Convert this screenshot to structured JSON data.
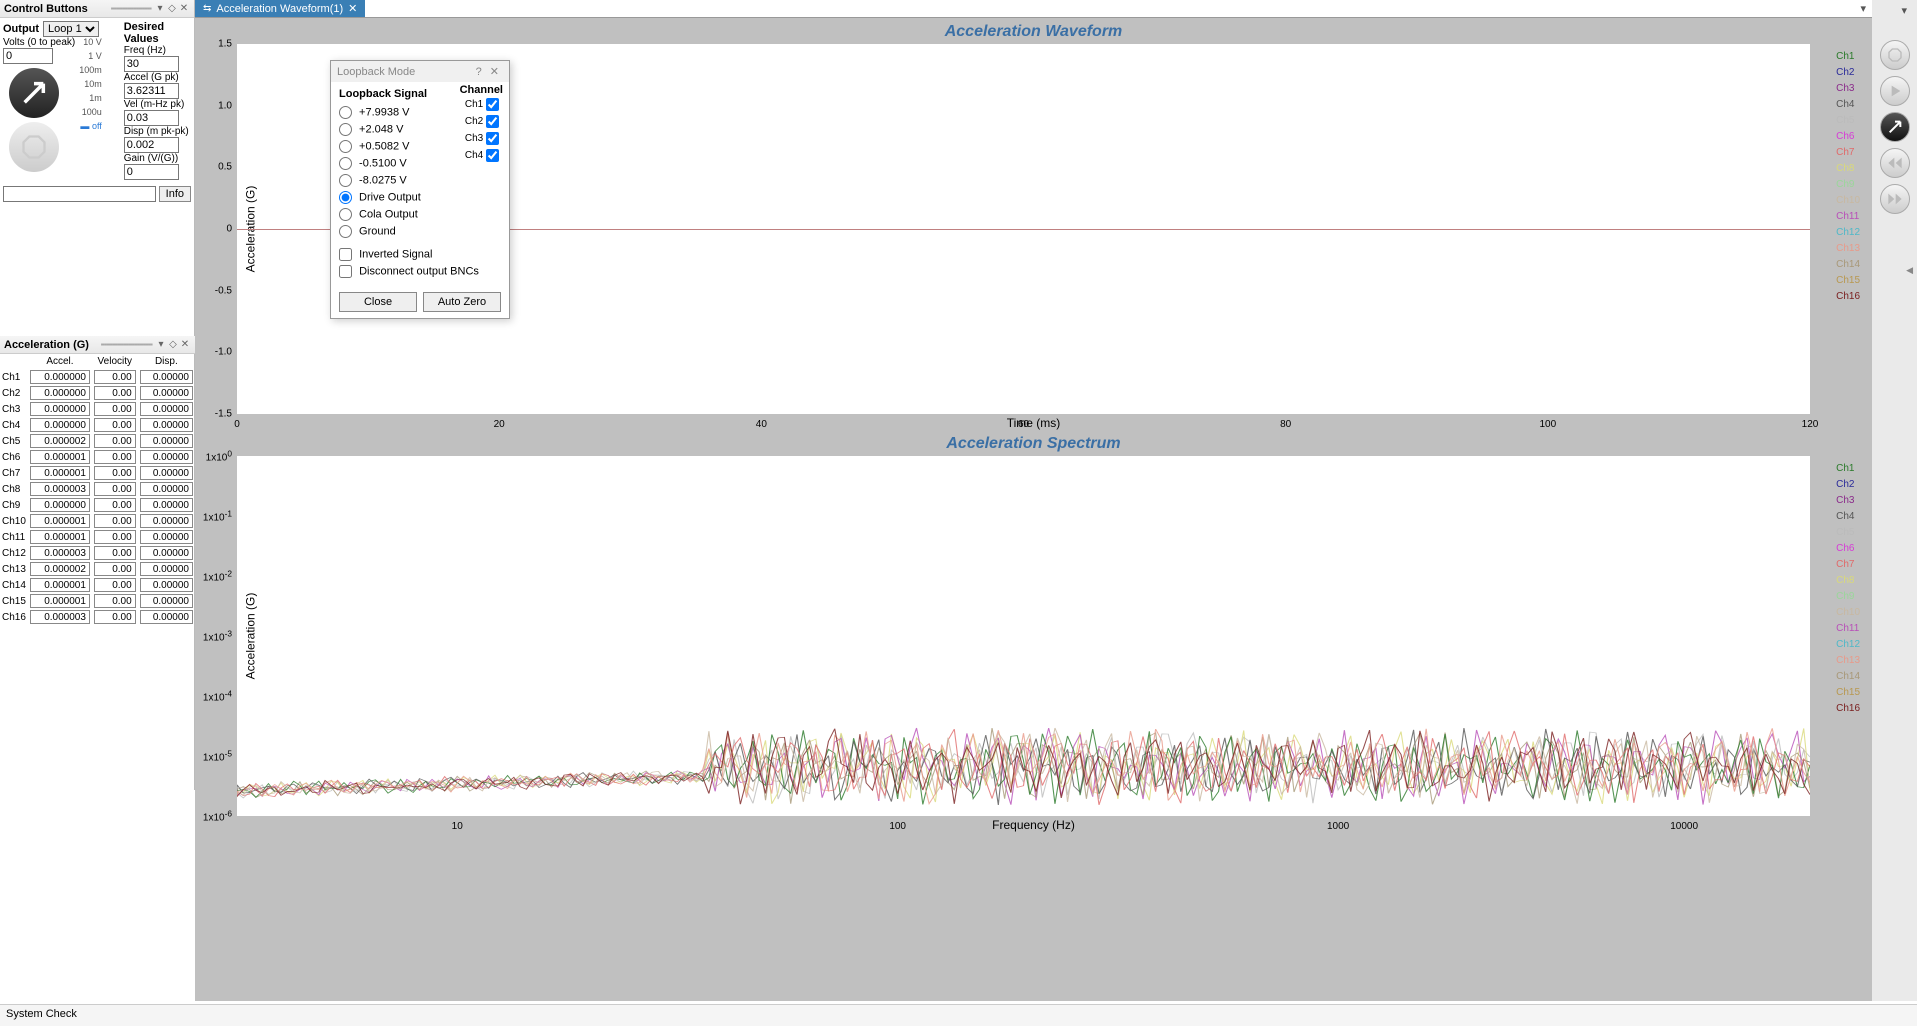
{
  "panels": {
    "control": {
      "title": "Control Buttons",
      "output_label": "Output",
      "loop_selected": "Loop 1",
      "volts_label": "Volts (0 to peak)",
      "volts_value": "0",
      "gain_scale": [
        "10 V",
        "1 V",
        "100m",
        "10m",
        "1m",
        "100u",
        "off"
      ],
      "info_btn": "Info",
      "desired_title": "Desired Values",
      "fields": [
        {
          "label": "Freq (Hz)",
          "value": "30"
        },
        {
          "label": "Accel (G pk)",
          "value": "3.62311"
        },
        {
          "label": "Vel (m-Hz pk)",
          "value": "0.03"
        },
        {
          "label": "Disp (m pk-pk)",
          "value": "0.002"
        },
        {
          "label": "Gain (V/(G))",
          "value": "0"
        }
      ]
    },
    "accel_table": {
      "title": "Acceleration (G)",
      "headers": [
        "Accel.",
        "Velocity",
        "Disp."
      ],
      "rows": [
        {
          "ch": "Ch1",
          "a": "0.000000",
          "v": "0.00",
          "d": "0.00000"
        },
        {
          "ch": "Ch2",
          "a": "0.000000",
          "v": "0.00",
          "d": "0.00000"
        },
        {
          "ch": "Ch3",
          "a": "0.000000",
          "v": "0.00",
          "d": "0.00000"
        },
        {
          "ch": "Ch4",
          "a": "0.000000",
          "v": "0.00",
          "d": "0.00000"
        },
        {
          "ch": "Ch5",
          "a": "0.000002",
          "v": "0.00",
          "d": "0.00000"
        },
        {
          "ch": "Ch6",
          "a": "0.000001",
          "v": "0.00",
          "d": "0.00000"
        },
        {
          "ch": "Ch7",
          "a": "0.000001",
          "v": "0.00",
          "d": "0.00000"
        },
        {
          "ch": "Ch8",
          "a": "0.000003",
          "v": "0.00",
          "d": "0.00000"
        },
        {
          "ch": "Ch9",
          "a": "0.000000",
          "v": "0.00",
          "d": "0.00000"
        },
        {
          "ch": "Ch10",
          "a": "0.000001",
          "v": "0.00",
          "d": "0.00000"
        },
        {
          "ch": "Ch11",
          "a": "0.000001",
          "v": "0.00",
          "d": "0.00000"
        },
        {
          "ch": "Ch12",
          "a": "0.000003",
          "v": "0.00",
          "d": "0.00000"
        },
        {
          "ch": "Ch13",
          "a": "0.000002",
          "v": "0.00",
          "d": "0.00000"
        },
        {
          "ch": "Ch14",
          "a": "0.000001",
          "v": "0.00",
          "d": "0.00000"
        },
        {
          "ch": "Ch15",
          "a": "0.000001",
          "v": "0.00",
          "d": "0.00000"
        },
        {
          "ch": "Ch16",
          "a": "0.000003",
          "v": "0.00",
          "d": "0.00000"
        }
      ]
    }
  },
  "tab": {
    "label": "Acceleration Waveform(1)"
  },
  "charts": {
    "waveform": {
      "title": "Acceleration Waveform",
      "ylabel": "Acceleration (G)",
      "xlabel": "Time (ms)",
      "xticks": [
        "0",
        "20",
        "40",
        "60",
        "80",
        "100",
        "120"
      ],
      "yticks": [
        "1.5",
        "1.0",
        "0.5",
        "0",
        "-0.5",
        "-1.0",
        "-1.5"
      ]
    },
    "spectrum": {
      "title": "Acceleration Spectrum",
      "ylabel": "Acceleration (G)",
      "xlabel": "Frequency (Hz)",
      "xticks": [
        "10",
        "100",
        "1000",
        "10000"
      ],
      "yticks": [
        "1x10^0",
        "1x10^-1",
        "1x10^-2",
        "1x10^-3",
        "1x10^-4",
        "1x10^-5",
        "1x10^-6"
      ]
    },
    "legend": [
      {
        "name": "Ch1",
        "color": "#2a7a2a"
      },
      {
        "name": "Ch2",
        "color": "#2a2a99"
      },
      {
        "name": "Ch3",
        "color": "#8a2a8a"
      },
      {
        "name": "Ch4",
        "color": "#555"
      },
      {
        "name": "Ch5",
        "color": "#bbb"
      },
      {
        "name": "Ch6",
        "color": "#d63cd6"
      },
      {
        "name": "Ch7",
        "color": "#e06a6a"
      },
      {
        "name": "Ch8",
        "color": "#d9d97a"
      },
      {
        "name": "Ch9",
        "color": "#9ad69a"
      },
      {
        "name": "Ch10",
        "color": "#c8b8a0"
      },
      {
        "name": "Ch11",
        "color": "#b84fb8"
      },
      {
        "name": "Ch12",
        "color": "#4fb8c8"
      },
      {
        "name": "Ch13",
        "color": "#e89a8a"
      },
      {
        "name": "Ch14",
        "color": "#a89878"
      },
      {
        "name": "Ch15",
        "color": "#b89850"
      },
      {
        "name": "Ch16",
        "color": "#7a2020"
      }
    ]
  },
  "dialog": {
    "title": "Loopback Mode",
    "signal_header": "Loopback Signal",
    "signals": [
      "+7.9938 V",
      "+2.048 V",
      "+0.5082 V",
      "-0.5100 V",
      "-8.0275 V",
      "Drive Output",
      "Cola Output",
      "Ground"
    ],
    "signal_selected": "Drive Output",
    "channel_header": "Channel",
    "channels": [
      "Ch1",
      "Ch2",
      "Ch3",
      "Ch4"
    ],
    "inverted_label": "Inverted Signal",
    "disconnect_label": "Disconnect output BNCs",
    "close_btn": "Close",
    "autozero_btn": "Auto Zero"
  },
  "status": "System Check",
  "chart_data": [
    {
      "type": "line",
      "title": "Acceleration Waveform",
      "xlabel": "Time (ms)",
      "ylabel": "Acceleration (G)",
      "xlim": [
        0,
        120
      ],
      "ylim": [
        -1.5,
        1.5
      ],
      "series": [
        {
          "name": "Ch1-16",
          "note": "flat at 0 G across full span",
          "x": [
            0,
            120
          ],
          "y": [
            0,
            0
          ]
        }
      ]
    },
    {
      "type": "line",
      "title": "Acceleration Spectrum",
      "xlabel": "Frequency (Hz)",
      "ylabel": "Acceleration (G)",
      "xscale": "log",
      "yscale": "log",
      "xlim": [
        5,
        30000
      ],
      "ylim": [
        1e-06,
        1
      ],
      "note": "16 channels of noise-floor spectra roughly between 1e-6 and 1e-5 G, rising density above ~500 Hz",
      "series_count": 16,
      "approx_envelope": {
        "x": [
          5,
          100,
          1000,
          10000,
          30000
        ],
        "y_low": [
          1e-06,
          1e-06,
          1e-06,
          1e-06,
          1e-06
        ],
        "y_high": [
          8e-06,
          8e-06,
          1.2e-05,
          1.2e-05,
          1.2e-05
        ]
      }
    }
  ]
}
